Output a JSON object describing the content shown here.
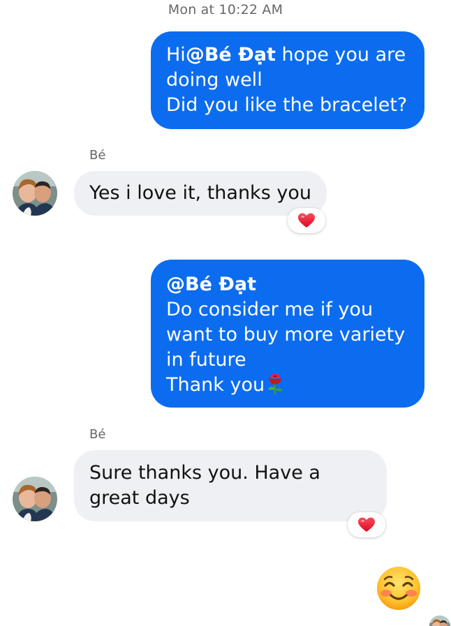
{
  "timestamp": "Mon at 10:22 AM",
  "messages": [
    {
      "direction": "outgoing",
      "mention": "@Bé Đạt",
      "pre": "Hi",
      "lines": [
        " hope you are",
        "doing well",
        "Did you like the bracelet?"
      ]
    },
    {
      "direction": "incoming",
      "sender": "Bé",
      "text": "Yes i love it, thanks you",
      "reaction": "heart-icon"
    },
    {
      "direction": "outgoing",
      "mention": "@Bé Đạt",
      "lines": [
        "Do consider me if you",
        "want to buy more variety",
        "in future",
        "Thank you"
      ],
      "emoji": "rose-icon"
    },
    {
      "direction": "incoming",
      "sender": "Bé",
      "lines": [
        "Sure thanks you. Have a",
        "great days"
      ],
      "reaction": "heart-icon"
    },
    {
      "direction": "outgoing",
      "emoji": "smiling-face-icon"
    }
  ],
  "colors": {
    "outgoing_bubble": "#0b6cf0",
    "incoming_bubble": "#eef0f3",
    "reaction_heart": "#e8112d",
    "meta_text": "#65676b"
  }
}
